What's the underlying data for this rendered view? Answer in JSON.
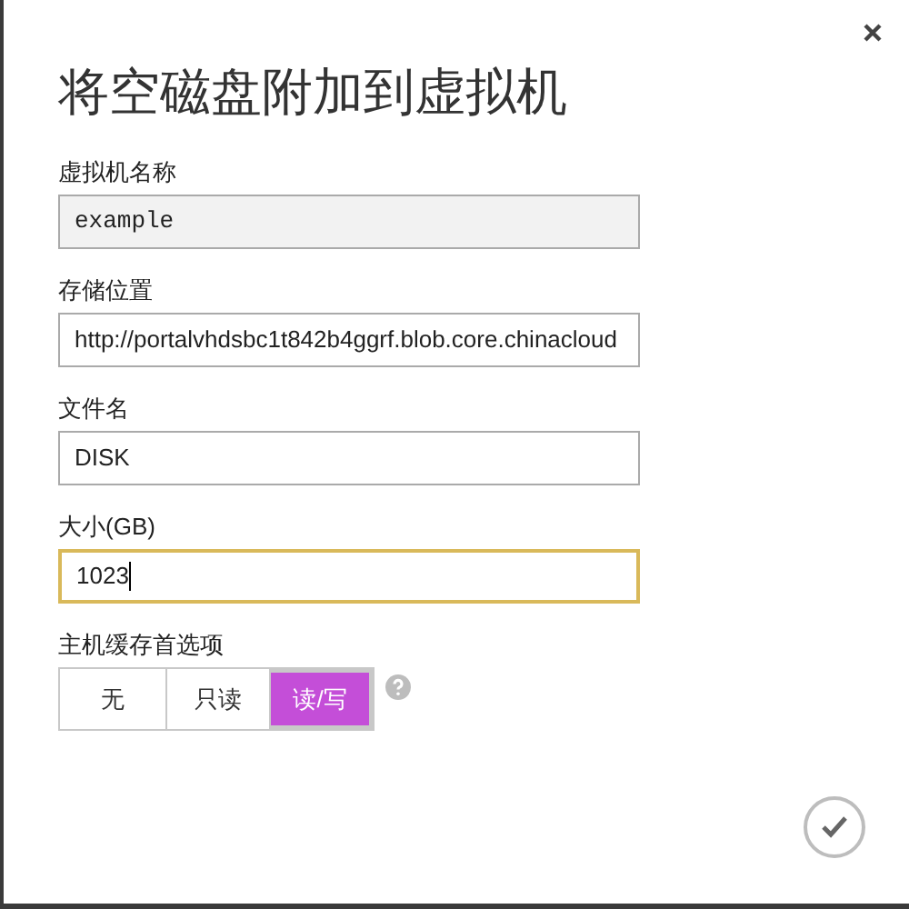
{
  "title": "将空磁盘附加到虚拟机",
  "fields": [
    {
      "label": "虚拟机名称",
      "value": "example",
      "readonly": true,
      "focused": false
    },
    {
      "label": "存储位置",
      "value": "http://portalvhdsbc1t842b4ggrf.blob.core.chinacloud",
      "readonly": false,
      "focused": false
    },
    {
      "label": "文件名",
      "value": "DISK",
      "readonly": false,
      "focused": false
    },
    {
      "label": "大小(GB)",
      "value": "1023",
      "readonly": false,
      "focused": true
    }
  ],
  "cache": {
    "label": "主机缓存首选项",
    "options": [
      {
        "label": "无",
        "selected": false
      },
      {
        "label": "只读",
        "selected": false
      },
      {
        "label": "读/写",
        "selected": true
      }
    ]
  }
}
